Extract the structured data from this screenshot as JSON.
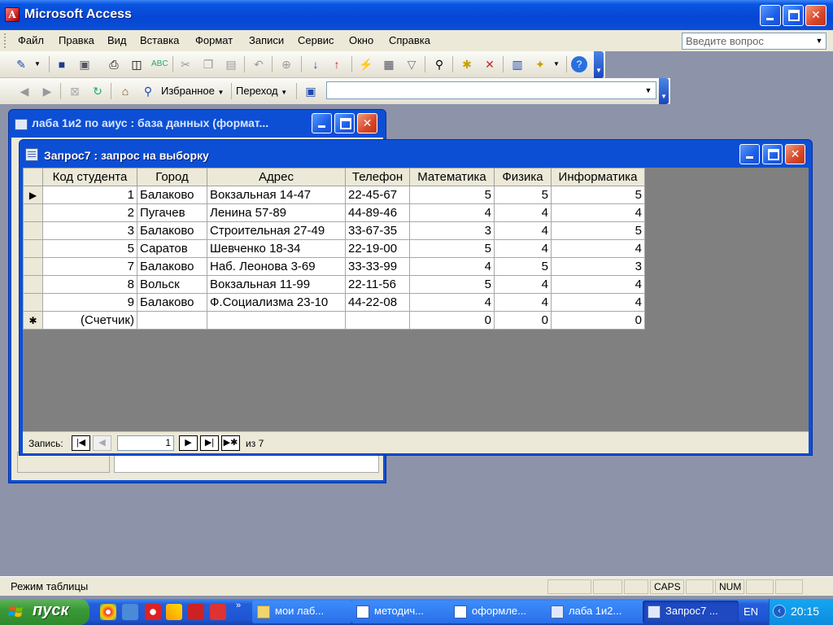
{
  "app": {
    "title": "Microsoft Access"
  },
  "menu": {
    "items": [
      "Файл",
      "Правка",
      "Вид",
      "Вставка",
      "Формат",
      "Записи",
      "Сервис",
      "Окно",
      "Справка"
    ],
    "ask_placeholder": "Введите вопрос"
  },
  "toolbar2": {
    "favorites": "Избранное",
    "go": "Переход"
  },
  "db_window": {
    "title": "лаба 1и2 по аиус : база данных (формат..."
  },
  "query_window": {
    "title": "Запрос7 : запрос на выборку",
    "columns": [
      "Код студента",
      "Город",
      "Адрес",
      "Телефон",
      "Математика",
      "Физика",
      "Информатика"
    ],
    "rows": [
      [
        "1",
        "Балаково",
        "Вокзальная 14-47",
        "22-45-67",
        "5",
        "5",
        "5"
      ],
      [
        "2",
        "Пугачев",
        "Ленина 57-89",
        "44-89-46",
        "4",
        "4",
        "4"
      ],
      [
        "3",
        "Балаково",
        "Строительная 27-49",
        "33-67-35",
        "3",
        "4",
        "5"
      ],
      [
        "5",
        "Саратов",
        "Шевченко 18-34",
        "22-19-00",
        "5",
        "4",
        "4"
      ],
      [
        "7",
        "Балаково",
        "Наб. Леонова 3-69",
        "33-33-99",
        "4",
        "5",
        "3"
      ],
      [
        "8",
        "Вольск",
        "Вокзальная 11-99",
        "22-11-56",
        "5",
        "4",
        "4"
      ],
      [
        "9",
        "Балаково",
        "Ф.Социализма 23-10",
        "44-22-08",
        "4",
        "4",
        "4"
      ]
    ],
    "new_row": [
      "(Счетчик)",
      "",
      "",
      "",
      "0",
      "0",
      "0"
    ],
    "nav": {
      "label": "Запись:",
      "current": "1",
      "of_label": "из",
      "total": "7"
    }
  },
  "status": {
    "text": "Режим таблицы",
    "caps": "CAPS",
    "num": "NUM"
  },
  "taskbar": {
    "start": "пуск",
    "tasks": [
      "мои лаб...",
      "методич...",
      "оформле...",
      "лаба 1и2...",
      "Запрос7 ..."
    ],
    "lang": "EN",
    "clock": "20:15"
  },
  "colors": {
    "title_blue": "#0a55e0",
    "start_green": "#3a9a37",
    "close_red": "#d8462a"
  }
}
